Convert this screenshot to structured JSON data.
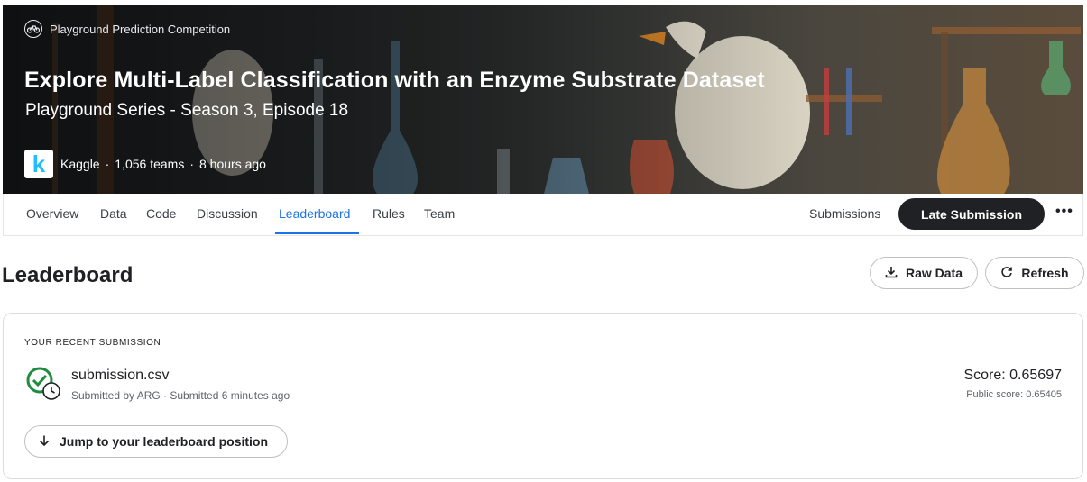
{
  "header": {
    "competition_type": "Playground Prediction Competition",
    "title": "Explore Multi-Label Classification with an Enzyme Substrate Dataset",
    "subtitle": "Playground Series - Season 3, Episode 18",
    "host_logo_letter": "k",
    "host": "Kaggle",
    "teams": "1,056 teams",
    "time_ago": "8 hours ago",
    "separator": "·"
  },
  "tabs": {
    "items": [
      "Overview",
      "Data",
      "Code",
      "Discussion",
      "Leaderboard",
      "Rules",
      "Team"
    ],
    "active": "Leaderboard",
    "submissions_label": "Submissions",
    "late_submission_label": "Late Submission",
    "more_label": "•••"
  },
  "leaderboard": {
    "title": "Leaderboard",
    "raw_data_label": "Raw Data",
    "refresh_label": "Refresh"
  },
  "recent_submission": {
    "section_label": "YOUR RECENT SUBMISSION",
    "filename": "submission.csv",
    "meta": "Submitted by ARG · Submitted 6 minutes ago",
    "score": "Score: 0.65697",
    "public_score": "Public score: 0.65405",
    "jump_label": "Jump to your leaderboard position"
  },
  "colors": {
    "accent": "#1a73e8",
    "success": "#1e8e3e",
    "dark_button": "#202124",
    "kaggle_blue": "#20beff"
  },
  "icons": {
    "competition_type": "bicycle-icon",
    "raw_data": "download-icon",
    "refresh": "refresh-icon",
    "status": "check-clock-icon",
    "jump": "arrow-down-icon"
  }
}
